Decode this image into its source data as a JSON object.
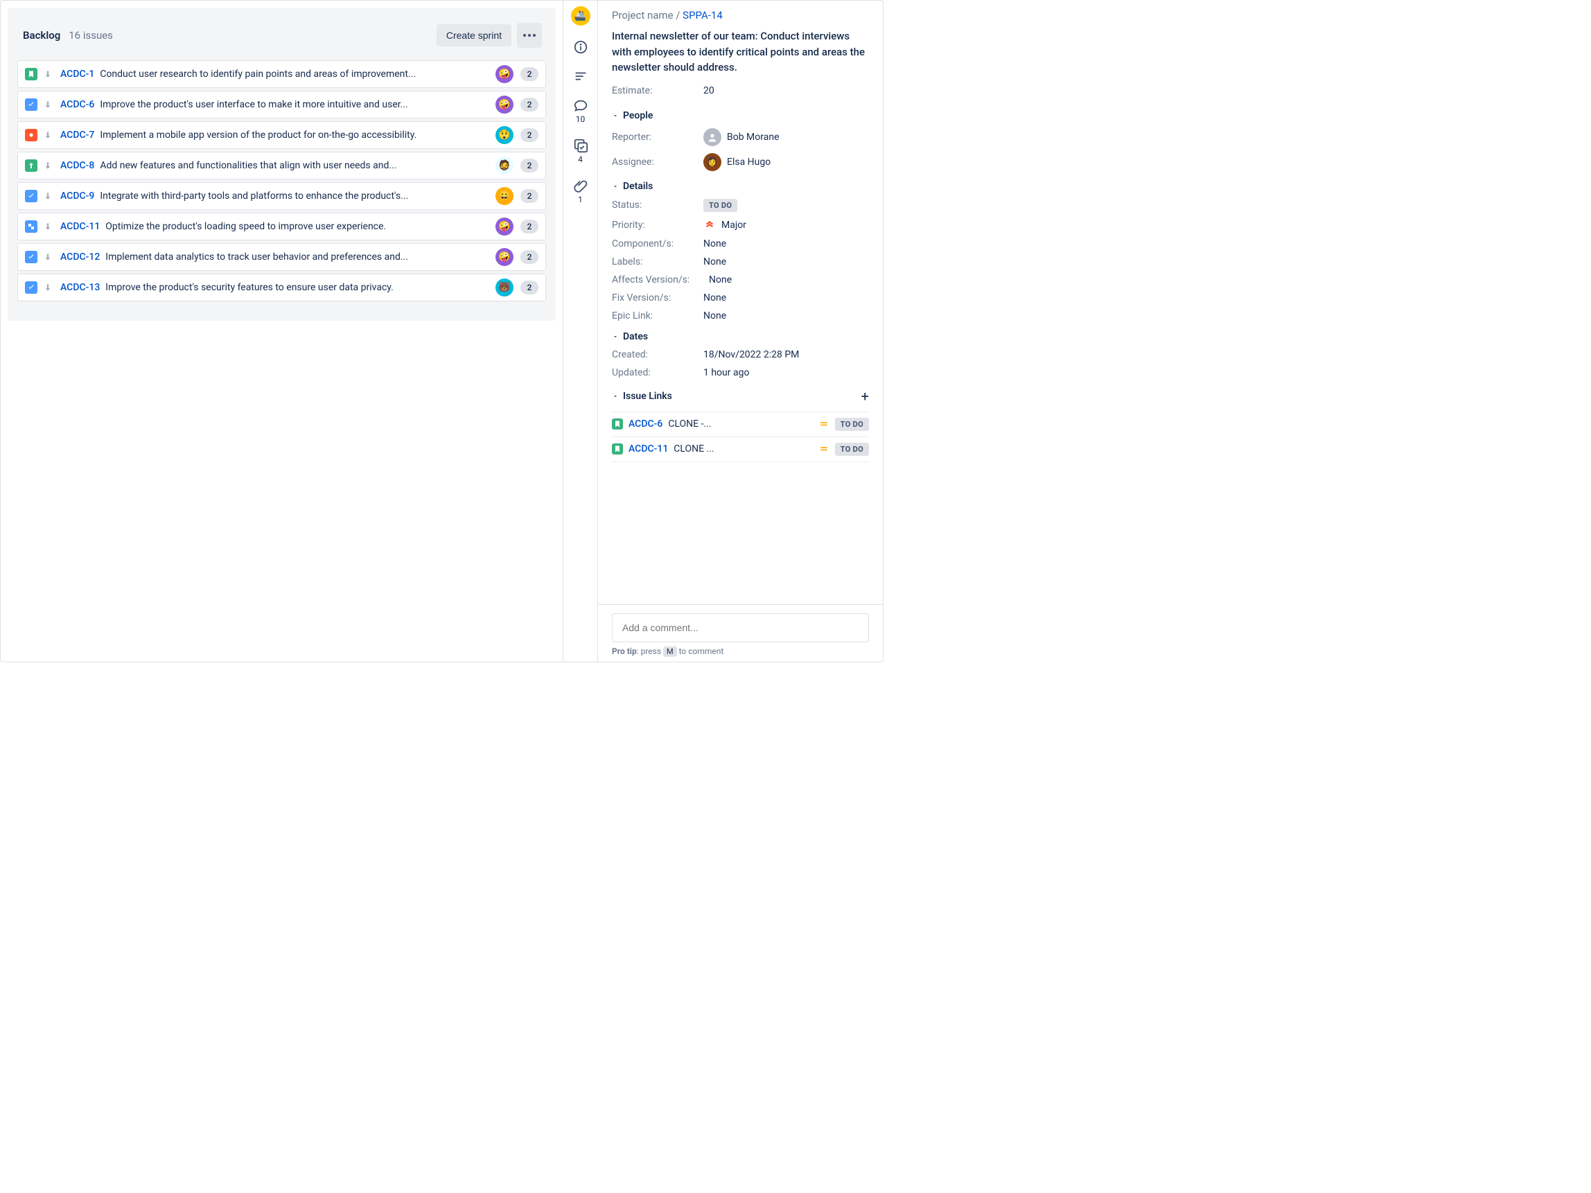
{
  "backlog": {
    "title": "Backlog",
    "count_label": "16 issues",
    "create_sprint_label": "Create sprint",
    "issues": [
      {
        "key": "ACDC-1",
        "type": "story",
        "summary": "Conduct user research to identify pain points and areas of improvement...",
        "avatar_bg": "#8E5DD8",
        "avatar_emoji": "🤪",
        "estimate": "2"
      },
      {
        "key": "ACDC-6",
        "type": "task",
        "summary": "Improve the product's user interface to make it more intuitive and user...",
        "avatar_bg": "#8E5DD8",
        "avatar_emoji": "🤪",
        "estimate": "2"
      },
      {
        "key": "ACDC-7",
        "type": "bug",
        "summary": "Implement a mobile app version of the product for on-the-go accessibility.",
        "avatar_bg": "#00B8D9",
        "avatar_emoji": "😲",
        "estimate": "2"
      },
      {
        "key": "ACDC-8",
        "type": "improve",
        "summary": "Add new features and functionalities that align with user needs and...",
        "avatar_bg": "#E6FCFF",
        "avatar_emoji": "🧔",
        "estimate": "2"
      },
      {
        "key": "ACDC-9",
        "type": "task",
        "summary": "Integrate with third-party tools and platforms to enhance the product's...",
        "avatar_bg": "#FFAB00",
        "avatar_emoji": "😀",
        "estimate": "2"
      },
      {
        "key": "ACDC-11",
        "type": "sub",
        "summary": "Optimize the product's loading speed to improve user experience.",
        "avatar_bg": "#8E5DD8",
        "avatar_emoji": "🤪",
        "estimate": "2"
      },
      {
        "key": "ACDC-12",
        "type": "task",
        "summary": "Implement data analytics to track user behavior and preferences and...",
        "avatar_bg": "#8E5DD8",
        "avatar_emoji": "🤪",
        "estimate": "2"
      },
      {
        "key": "ACDC-13",
        "type": "task",
        "summary": "Improve the product's security features to ensure user data privacy.",
        "avatar_bg": "#00B8D9",
        "avatar_emoji": "🐻",
        "estimate": "2"
      }
    ]
  },
  "rail": {
    "comments_count": "10",
    "subtasks_count": "4",
    "attachments_count": "1"
  },
  "detail": {
    "breadcrumb_project": "Project name",
    "breadcrumb_sep": " / ",
    "breadcrumb_key": "SPPA-14",
    "title": "Internal newsletter of our team: Conduct interviews with employees to identify critical points and areas the newsletter should address.",
    "estimate_label": "Estimate:",
    "estimate_value": "20",
    "people": {
      "section_label": "People",
      "reporter_label": "Reporter:",
      "assignee_label": "Assignee:",
      "reporter_name": "Bob Morane",
      "assignee_name": "Elsa Hugo"
    },
    "details": {
      "section_label": "Details",
      "status_label": "Status:",
      "status_value": "TO DO",
      "priority_label": "Priority:",
      "priority_value": "Major",
      "components_label": "Component/s:",
      "components_value": "None",
      "labels_label": "Labels:",
      "labels_value": "None",
      "affects_label": "Affects Version/s:",
      "affects_value": "None",
      "fix_label": "Fix Version/s:",
      "fix_value": "None",
      "epic_label": "Epic Link:",
      "epic_value": "None"
    },
    "dates": {
      "section_label": "Dates",
      "created_label": "Created:",
      "created_value": "18/Nov/2022 2:28 PM",
      "updated_label": "Updated:",
      "updated_value": "1 hour ago"
    },
    "links": {
      "section_label": "Issue Links",
      "items": [
        {
          "key": "ACDC-6",
          "summary_display": "CLONE -...",
          "status": "TO DO"
        },
        {
          "key": "ACDC-11",
          "summary_display": "CLONE ...",
          "status": "TO DO"
        }
      ]
    },
    "comment_placeholder": "Add a comment...",
    "protip_prefix": "Pro tip",
    "protip_mid": ": press ",
    "protip_key": "M",
    "protip_suffix": " to comment"
  }
}
